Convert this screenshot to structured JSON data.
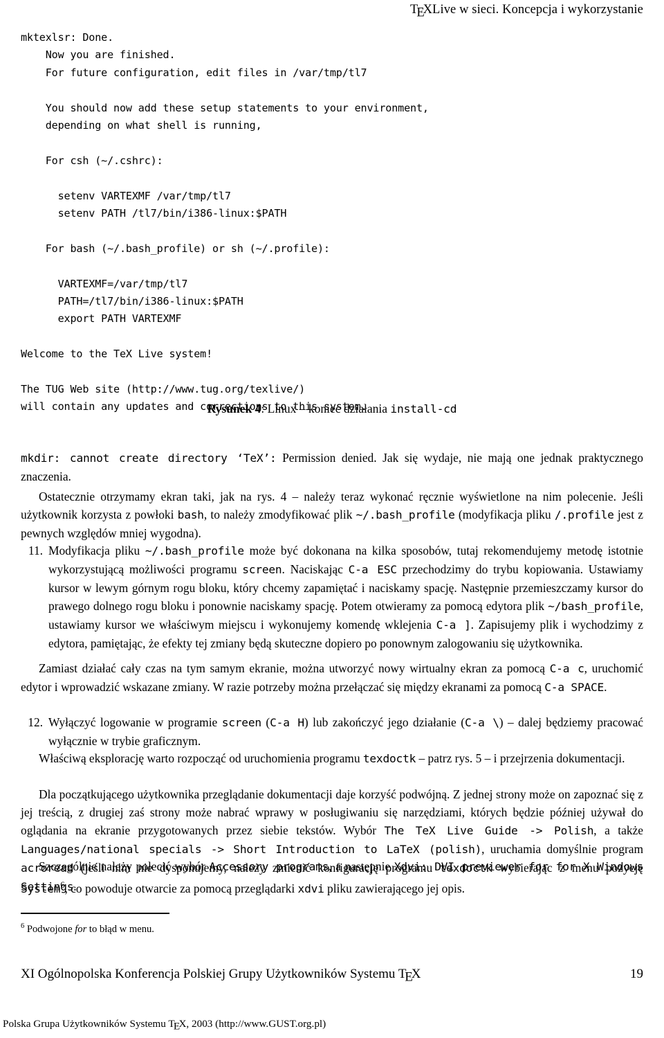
{
  "running_head": {
    "prefix": "T",
    "e": "E",
    "suffix": "XLive w sieci. Koncepcja i wykorzystanie"
  },
  "terminal_output": {
    "lines": [
      "mktexlsr: Done.",
      "    Now you are finished.",
      "    For future configuration, edit files in /var/tmp/tl7",
      "",
      "    You should now add these setup statements to your environment,",
      "    depending on what shell is running,",
      "",
      "    For csh (~/.cshrc):",
      "",
      "      setenv VARTEXMF /var/tmp/tl7",
      "      setenv PATH /tl7/bin/i386-linux:$PATH",
      "",
      "    For bash (~/.bash_profile) or sh (~/.profile):",
      "",
      "      VARTEXMF=/var/tmp/tl7",
      "      PATH=/tl7/bin/i386-linux:$PATH",
      "      export PATH VARTEXMF",
      "",
      "Welcome to the TeX Live system!",
      "",
      "The TUG Web site (http://www.tug.org/texlive/)",
      "will contain any updates and corrections to this system."
    ]
  },
  "figure": {
    "label": "Rysunek 4",
    "separator": ": ",
    "caption_text": "Linux – koniec działania ",
    "caption_code": "install-cd"
  },
  "paragraphs": {
    "p_mkdir_code": "mkdir: cannot create directory ‘TeX’:",
    "p_mkdir_rest": " Permission denied. Jak się wydaje, nie mają one jednak praktycznego znaczenia.",
    "p_final_a": "Ostatecznie otrzymamy ekran taki, jak na rys. 4 – należy teraz wykonać ręcznie wyświetlone na nim polecenie. Jeśli użytkownik korzysta z powłoki ",
    "p_final_bash": "bash",
    "p_final_b": ", to należy zmodyfikować plik ",
    "p_final_file1": "~/.bash_profile",
    "p_final_c": " (modyfikacja pliku ",
    "p_final_file2": "/.profile",
    "p_final_d": " jest z pewnych względów mniej wygodna)."
  },
  "items": [
    {
      "number": "11.",
      "segments": [
        {
          "t": "text",
          "v": "Modyfikacja pliku "
        },
        {
          "t": "code",
          "v": "~/.bash_profile"
        },
        {
          "t": "text",
          "v": " może być dokonana na kilka sposobów, tutaj rekomendujemy metodę istotnie wykorzystującą możliwości programu "
        },
        {
          "t": "code",
          "v": "screen"
        },
        {
          "t": "text",
          "v": ". Naciskając "
        },
        {
          "t": "code",
          "v": "C-a ESC"
        },
        {
          "t": "text",
          "v": " przechodzimy do trybu kopiowania. Ustawiamy kursor w lewym górnym rogu bloku, który chcemy zapamiętać i naciskamy spację. Następnie przemieszczamy kursor do prawego dolnego rogu bloku i ponownie naciskamy spację. Potem otwieramy za pomocą edytora plik "
        },
        {
          "t": "code",
          "v": "~/bash_profile"
        },
        {
          "t": "text",
          "v": ", ustawiamy kursor we właściwym miejscu i wykonujemy komendę wklejenia "
        },
        {
          "t": "code",
          "v": "C-a ]"
        },
        {
          "t": "text",
          "v": ". Zapisujemy plik i wychodzimy z edytora, pamiętając, że efekty tej zmiany będą skuteczne dopiero po ponownym zalogowaniu się użytkownika."
        }
      ]
    },
    {
      "number": "12.",
      "segments": [
        {
          "t": "text",
          "v": "Wyłączyć logowanie w programie "
        },
        {
          "t": "code",
          "v": "screen"
        },
        {
          "t": "text",
          "v": " ("
        },
        {
          "t": "code",
          "v": "C-a H"
        },
        {
          "t": "text",
          "v": ") lub zakończyć jego działanie ("
        },
        {
          "t": "code",
          "v": "C-a \\"
        },
        {
          "t": "text",
          "v": ") – dalej będziemy pracować wyłącznie w trybie graficznym."
        }
      ]
    }
  ],
  "para_screen": {
    "segments": [
      {
        "t": "text",
        "v": "Zamiast działać cały czas na tym samym ekranie, można utworzyć nowy wirtualny ekran za pomocą "
      },
      {
        "t": "code",
        "v": "C-a c"
      },
      {
        "t": "text",
        "v": ", uruchomić edytor i wprowadzić wskazane zmiany. W razie potrzeby można przełączać się między ekranami za pomocą "
      },
      {
        "t": "code",
        "v": "C-a SPACE"
      },
      {
        "t": "text",
        "v": "."
      }
    ]
  },
  "para_texdoctk": {
    "segments": [
      {
        "t": "text",
        "v": "Właściwą eksplorację warto rozpocząć od uruchomienia programu "
      },
      {
        "t": "code",
        "v": "texdoctk"
      },
      {
        "t": "text",
        "v": " – patrz rys. 5 – i przejrzenia dokumentacji."
      }
    ]
  },
  "para_docs": {
    "segments": [
      {
        "t": "text",
        "v": "Dla początkującego użytkownika przeglądanie dokumentacji daje korzyść podwójną. Z jednej strony może on zapoznać się z jej treścią, z drugiej zaś strony może nabrać wprawy w posługiwaniu się narzędziami, których będzie później używał do oglądania na ekranie przygotowanych przez siebie tekstów. Wybór "
      },
      {
        "t": "code",
        "v": "The TeX Live Guide -> Polish"
      },
      {
        "t": "text",
        "v": ", a także "
      },
      {
        "t": "code",
        "v": "Languages/national specials -> Short Introduction to LaTeX (polish)"
      },
      {
        "t": "text",
        "v": ", uruchamia domyślnie program "
      },
      {
        "t": "code",
        "v": "acroread"
      },
      {
        "t": "text",
        "v": " (jeśli nim nie dysponujemy, należy zmienić konfigurację programu "
      },
      {
        "t": "code",
        "v": "texdoctk"
      },
      {
        "t": "text",
        "v": " wybierając z menu pozycję "
      },
      {
        "t": "code",
        "v": "Settings"
      },
      {
        "t": "text",
        "v": "."
      }
    ]
  },
  "para_accessory": {
    "segments": [
      {
        "t": "text",
        "v": "Szczególnie należy polecić wybór "
      },
      {
        "t": "code",
        "v": "Accessory programs"
      },
      {
        "t": "text",
        "v": ", a następnie "
      },
      {
        "t": "code",
        "v": "Xdvi: DVI previewer for for X Windows System"
      },
      {
        "t": "sup",
        "v": "6"
      },
      {
        "t": "text",
        "v": ", co powoduje otwarcie za pomocą przeglądarki "
      },
      {
        "t": "code",
        "v": "xdvi"
      },
      {
        "t": "text",
        "v": " pliku zawierającego jej opis."
      }
    ]
  },
  "footnote": {
    "marker": "6",
    "pre": " Podwojone ",
    "italic": "for",
    "post": " to błąd w menu."
  },
  "footer": {
    "conference_pre": "XI Ogólnopolska Konferencja Polskiej Grupy Użytkowników Systemu ",
    "conference_tex_t": "T",
    "conference_tex_e": "E",
    "conference_tex_x": "X",
    "page_number": "19"
  },
  "colophon": {
    "pre": "Polska Grupa Użytkowników Systemu ",
    "tex_t": "T",
    "tex_e": "E",
    "tex_x": "X",
    "post": ", 2003 (http://www.GUST.org.pl)"
  }
}
